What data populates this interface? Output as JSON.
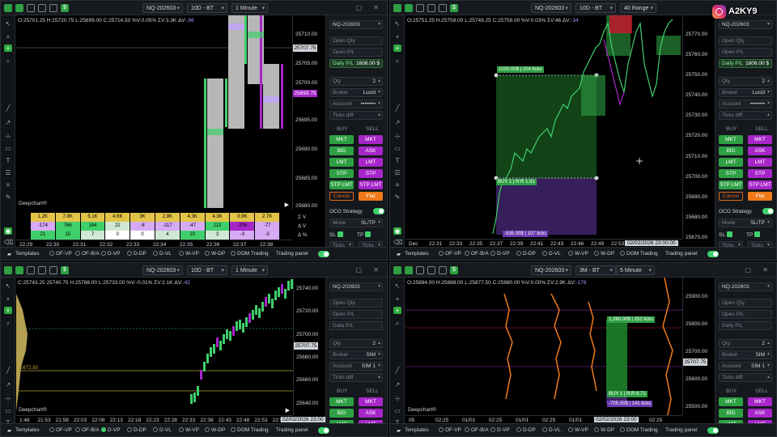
{
  "instagram": {
    "handle": "A2KY9"
  },
  "common": {
    "symbol": "NQ-202603",
    "logo": "Deepchart®",
    "templates": "Templates",
    "overlays": [
      "OF-VP",
      "OF-B/A",
      "D-VP",
      "D-DP",
      "D-VL",
      "W-VP",
      "W-DP",
      "DOM Trading"
    ],
    "trading_panel": "Trading panel",
    "panel": {
      "open_qty": "Open Qty",
      "open_pl": "Open P/L",
      "daily_pl": "Daily P/L",
      "qty": "Qty",
      "broker": "Broker",
      "account": "Account",
      "ticks_diff": "Ticks diff",
      "buy": "BUY",
      "sell": "SELL",
      "mkt": "MKT",
      "bid": "BID",
      "ask": "ASK",
      "lmt": "LMT",
      "stp": "STP",
      "stp_lmt": "STP LMT",
      "cancel": "Cancel",
      "flat": "Flat",
      "oco": "OCO Strategy",
      "mode": "Mode",
      "mode_val": "SL/TP",
      "sl": "SL",
      "tp": "TP",
      "ticks": "Ticks"
    }
  },
  "w1": {
    "range": "10D - BT",
    "tf": "1 Minute",
    "info": {
      "o": "O:25701.25",
      "h": "H:25720.75",
      "l": "L:25699.00",
      "c": "C:25714.50",
      "pct": "%V:0.05%",
      "sv": "ΣV:3.3K",
      "dv": "ΔV:",
      "dvv": "-96"
    },
    "yticks": [
      "25710.00",
      "25705.00",
      "25700.00",
      "25695.00",
      "25690.00",
      "25685.00",
      "25680.00"
    ],
    "price_tag": "25707.75",
    "price_tag2": "25699.75",
    "xticks": [
      "22:29",
      "22:30",
      "22:31",
      "22:32",
      "22:33",
      "22:34",
      "22:35",
      "22:36",
      "22:37",
      "22:38"
    ],
    "stats_labels": [
      "Σ V",
      "Δ V",
      "Δ %"
    ],
    "stats_rows": [
      [
        "1.2K",
        "7.8K",
        "5.1K",
        "4.6K",
        "3K",
        "2.8K",
        "4.3K",
        "4.3K",
        "3.9K",
        "2.7K"
      ],
      [
        "-174",
        "766",
        "164",
        "22",
        "-8",
        "-117",
        "-47",
        "113",
        "-206",
        "-77"
      ],
      [
        "21",
        "15",
        "7",
        "0",
        "0",
        "4",
        "10",
        "3",
        "-3",
        "-3"
      ]
    ],
    "daily_pl": "1606.00 $",
    "qty": "2",
    "broker": "Lucid",
    "account": "••••••••"
  },
  "w2": {
    "range": "10D - BT",
    "tf": "40 Range",
    "info": {
      "o": "O:25751.25",
      "h": "H:25759.00",
      "l": "L:25749.25",
      "c": "C:25759.00",
      "pct": "%V:0.03%",
      "sv": "ΣV:46",
      "dv": "ΔV:",
      "dvv": "-34"
    },
    "yticks": [
      "25770.00",
      "25760.00",
      "25750.00",
      "25740.00",
      "25730.00",
      "25720.00",
      "25710.00",
      "25700.00",
      "25690.00",
      "25680.00",
      "25670.00"
    ],
    "xticks": [
      "Dec",
      "22:31",
      "22:33",
      "22:35",
      "22:37",
      "22:39",
      "22:41",
      "22:43",
      "22:46",
      "22:49",
      "22:53",
      "22:57"
    ],
    "date_tag": "02/02/2026 23:00:00",
    "tp_label": "1020.00$ | 204 ticks",
    "buy_label": "BUY 1 | R:R 1.91",
    "sl_label": "-535.00$ | 107 ticks",
    "daily_pl": "1606.00 $",
    "qty": "2",
    "broker": "Lucid",
    "account": "••••••••"
  },
  "w3": {
    "range": "10D - BT",
    "tf": "1 Minute",
    "info": {
      "c": "C:25743.25",
      "o": "25740.75",
      "h": "H:25788.00",
      "l": "L:25733.00",
      "pct": "%V:-0.01%",
      "sv": "ΣV:2.1K",
      "dv": "ΔV:",
      "dvv": "-42"
    },
    "yticks": [
      "25740.00",
      "25720.00",
      "25700.00",
      "25680.00",
      "25660.00",
      "25640.00"
    ],
    "price_tag": "25707.75",
    "lvl": "25672.85",
    "xticks": [
      "1:48",
      "21:53",
      "21:58",
      "22:03",
      "22:08",
      "22:13",
      "22:18",
      "22:23",
      "22:28",
      "22:33",
      "22:38",
      "22:43",
      "22:48",
      "22:53",
      "22:58"
    ],
    "date_tag": "02/02/2026 23:00",
    "qty": "2",
    "broker": "SIM",
    "account": "SIM 1"
  },
  "w4": {
    "range": "3M - BT",
    "tf": "5 Minute",
    "info": {
      "o": "O:25884.00",
      "h": "H:25888.00",
      "l": "L:25877.50",
      "c": "C:25880.00",
      "pct": "%V:0.00%",
      "sv": "ΣV:2.9K",
      "dv": "ΔV:",
      "dvv": "-178"
    },
    "yticks": [
      "25900.00",
      "25800.00",
      "25700.00",
      "25600.00",
      "25500.00"
    ],
    "price_tag": "25707.75",
    "xticks": [
      "05",
      "02:25",
      "01/01",
      "02:25",
      "01/01",
      "02:25",
      "01/01",
      "02:25",
      "01/01",
      "02:25"
    ],
    "date_tag": "02/02/2026 23:00",
    "tp_label": "1,260.00$ | 252 ticks",
    "buy_label": "BUY 1 | R:R 6.71",
    "sl_label": "-705.00$ | 141 ticks",
    "qty": "2",
    "broker": "SIM",
    "account": "SIM 1"
  },
  "colors": {
    "green": "#3fd06b",
    "purple": "#a726c9",
    "orange": "#f07a1a",
    "bg": "#000000"
  }
}
